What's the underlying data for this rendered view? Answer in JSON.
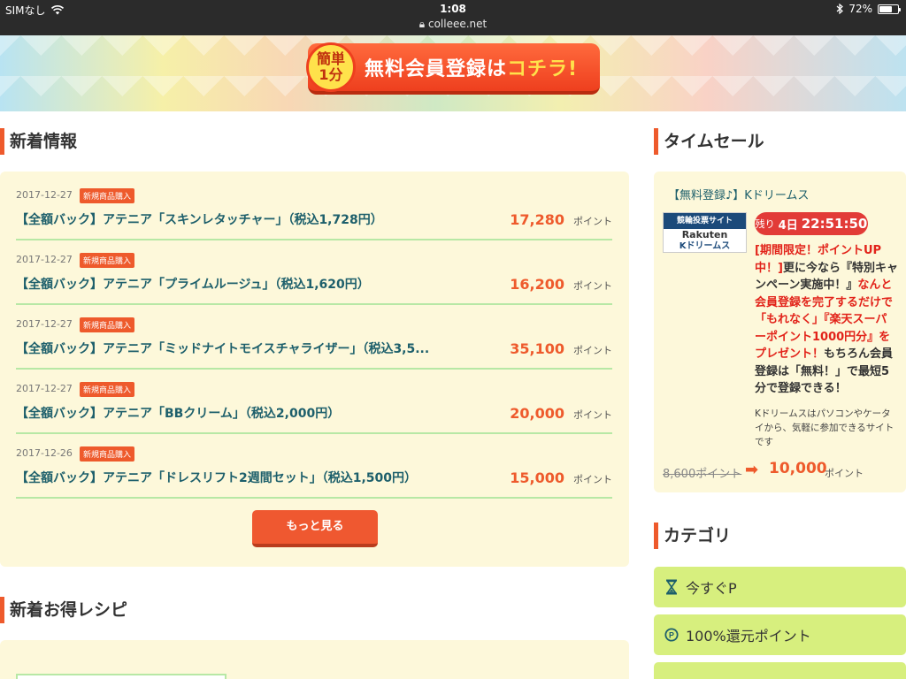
{
  "status_bar": {
    "carrier": "SIMなし",
    "time": "1:08",
    "url": "colleee.net",
    "battery": "72%",
    "battery_level": 0.72
  },
  "banner": {
    "badge_line1": "簡単",
    "badge_line2": "1分",
    "text_main": "無料会員登録は",
    "text_accent": "コチラ!"
  },
  "news": {
    "title": "新着情報",
    "points_unit": "ポイント",
    "items": [
      {
        "date": "2017-12-27",
        "tag": "新規商品購入",
        "title": "【全額バック】アテニア「スキンレタッチャー」（税込1,728円）",
        "points": "17,280"
      },
      {
        "date": "2017-12-27",
        "tag": "新規商品購入",
        "title": "【全額バック】アテニア「プライムルージュ」（税込1,620円）",
        "points": "16,200"
      },
      {
        "date": "2017-12-27",
        "tag": "新規商品購入",
        "title": "【全額バック】アテニア「ミッドナイトモイスチャライザー」（税込3,5...",
        "points": "35,100"
      },
      {
        "date": "2017-12-27",
        "tag": "新規商品購入",
        "title": "【全額バック】アテニア「BBクリーム」（税込2,000円）",
        "points": "20,000"
      },
      {
        "date": "2017-12-26",
        "tag": "新規商品購入",
        "title": "【全額バック】アテニア「ドレスリフト2週間セット」（税込1,500円）",
        "points": "15,000"
      }
    ],
    "more_label": "もっと見る"
  },
  "recipes": {
    "title": "新着お得レシピ"
  },
  "time_sale": {
    "title": "タイムセール",
    "link": "【無料登録♪】Kドリームス",
    "logo_top": "競輪投票サイト",
    "logo_mid": "Rakuten",
    "logo_bot": "Kドリームス",
    "timer_label": "残り",
    "timer_days": "4日",
    "timer_time": "22:51:50",
    "desc_red1": "[期間限定！ポイントUP中！]",
    "desc_black1": "更に今なら『特別キャンペーン実施中！』",
    "desc_red2": "なんと会員登録を完了するだけで「もれなく」『楽天スーパーポイント1000円分』をプレゼント！",
    "desc_black2": "もちろん会員登録は「無料！」で最短5分で登録できる！",
    "note": "Kドリームスはパソコンやケータイから、気軽に参加できるサイトです",
    "old_points": "8,600ポイント",
    "new_points": "10,000",
    "points_unit": "ポイント"
  },
  "category": {
    "title": "カテゴリ",
    "items": [
      {
        "label": "今すぐP",
        "icon": "hourglass-icon"
      },
      {
        "label": "100%還元ポイント",
        "icon": "point-circle-icon"
      }
    ]
  },
  "colors": {
    "accent": "#ee5a2c",
    "link": "#1d5f6b",
    "panel_bg": "#fdf8da",
    "category_bg": "#d7ef7e"
  }
}
